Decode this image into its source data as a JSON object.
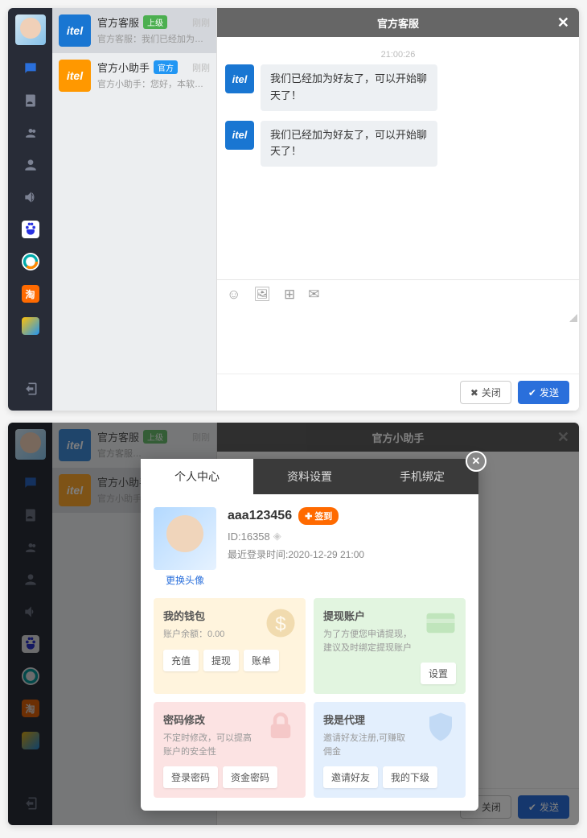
{
  "window1": {
    "header_title": "官方客服",
    "conversations": [
      {
        "name": "官方客服",
        "badge": "上级",
        "badge_class": "badge-green",
        "time": "刚刚",
        "preview": "官方客服：我们已经加为好友了...",
        "ava": "itel",
        "ava_class": "blue",
        "selected": true
      },
      {
        "name": "官方小助手",
        "badge": "官方",
        "badge_class": "badge-blue",
        "time": "刚刚",
        "preview": "官方小助手：您好，本软件正在...",
        "ava": "itel",
        "ava_class": "orange",
        "selected": false
      }
    ],
    "timestamp": "21:00:26",
    "messages": [
      {
        "text": "我们已经加为好友了，可以开始聊天了！"
      },
      {
        "text": "我们已经加为好友了，可以开始聊天了！"
      }
    ],
    "close_label": "关闭",
    "send_label": "发送"
  },
  "window2": {
    "header_title": "官方小助手",
    "tabs": [
      "个人中心",
      "资料设置",
      "手机绑定"
    ],
    "active_tab": 0,
    "username": "aaa123456",
    "signin": "签到",
    "uid": "ID:16358",
    "last_login": "最近登录时间:2020-12-29 21:00",
    "change_avatar": "更换头像",
    "cards": {
      "wallet": {
        "title": "我的钱包",
        "sub": "账户余额：0.00",
        "btns": [
          "充值",
          "提现",
          "账单"
        ]
      },
      "withdraw": {
        "title": "提现账户",
        "sub": "为了方便您申请提现，建议及时绑定提现账户",
        "btns": [
          "设置"
        ]
      },
      "password": {
        "title": "密码修改",
        "sub": "不定时修改，可以提高账户的安全性",
        "btns": [
          "登录密码",
          "资金密码"
        ]
      },
      "agent": {
        "title": "我是代理",
        "sub": "邀请好友注册,可赚取佣金",
        "btns": [
          "邀请好友",
          "我的下级"
        ]
      }
    },
    "close_label": "关闭",
    "send_label": "发送"
  }
}
